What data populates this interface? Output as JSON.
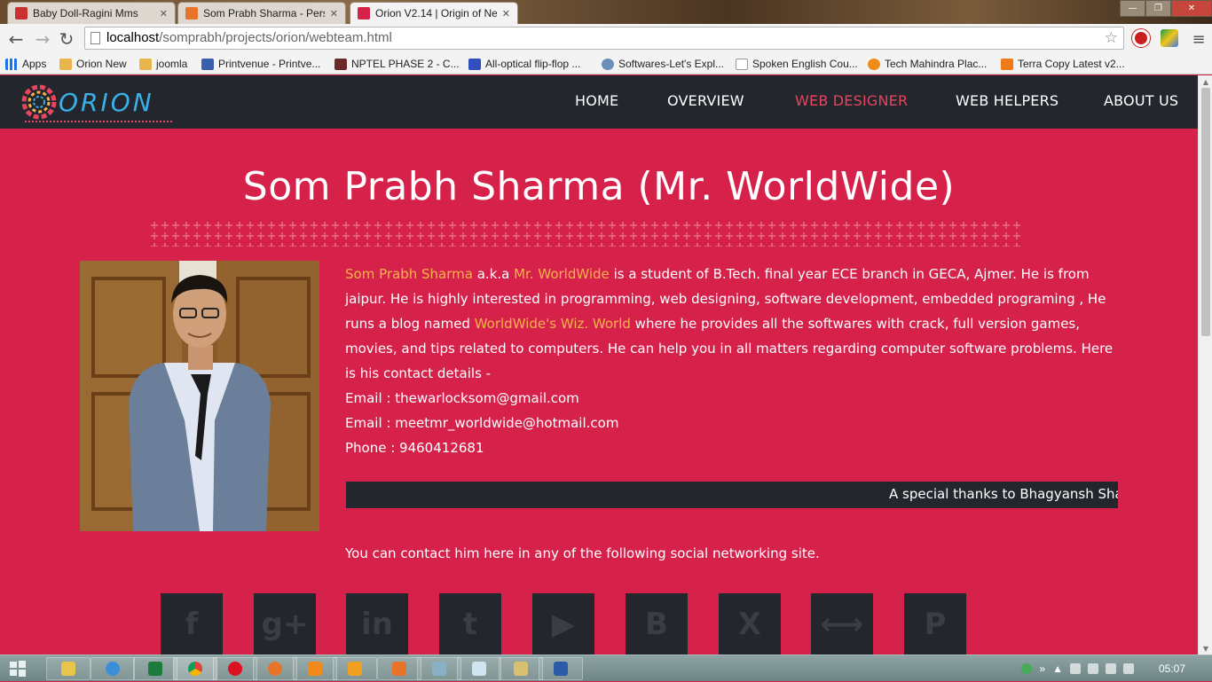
{
  "browser": {
    "tabs": [
      {
        "label": "Baby Doll-Ragini Mms",
        "icon": "gaana-icon",
        "color": "#c8312f"
      },
      {
        "label": "Som Prabh Sharma - Pers",
        "icon": "orion-icon",
        "color": "#e8742b"
      },
      {
        "label": "Orion V2.14 | Origin of Ne",
        "icon": "orion-icon",
        "color": "#d6214a"
      }
    ],
    "url_host": "localhost",
    "url_path": "/somprabh/projects/orion/webteam.html",
    "bookmarks": [
      {
        "label": "Apps",
        "icon": "apps-grid-icon"
      },
      {
        "label": "Orion New",
        "icon": "folder-icon"
      },
      {
        "label": "joomla",
        "icon": "folder-icon"
      },
      {
        "label": "Printvenue - Printve...",
        "icon": "printvenue-icon"
      },
      {
        "label": "NPTEL PHASE 2 - C...",
        "icon": "nptel-icon"
      },
      {
        "label": "All-optical flip-flop ...",
        "icon": "document-icon"
      },
      {
        "label": "Softwares-Let's Expl...",
        "icon": "globe-icon"
      },
      {
        "label": "Spoken English Cou...",
        "icon": "page-icon"
      },
      {
        "label": "Tech Mahindra Plac...",
        "icon": "info-icon"
      },
      {
        "label": "Terra Copy Latest v2...",
        "icon": "blogger-icon"
      }
    ]
  },
  "site": {
    "logo_text": "ORION",
    "nav": [
      "HOME",
      "OVERVIEW",
      "WEB DESIGNER",
      "WEB HELPERS",
      "ABOUT US"
    ],
    "active_nav": "WEB DESIGNER",
    "title": "Som Prabh Sharma (Mr. WorldWide)",
    "bio": {
      "name": "Som Prabh Sharma",
      "aka": " a.k.a ",
      "alias": "Mr. WorldWide",
      "text1": " is a student of B.Tech. final year ECE branch in GECA, Ajmer. He is from jaipur. He is highly interested in programming, web designing, software development, embedded programing , He runs a blog named ",
      "blog": "WorldWide's Wiz. World",
      "text2": " where he provides all the softwares with crack, full version games, movies, and tips related to computers. He can help you in all matters regarding computer software problems. Here is his contact details -",
      "email1": "Email : thewarlocksom@gmail.com",
      "email2": "Email : meetmr_worldwide@hotmail.com",
      "phone": "Phone : 9460412681"
    },
    "marquee": "A special thanks to Bhagyansh Sha",
    "contact_msg": "You can contact him here in any of the following social networking site.",
    "social": [
      {
        "name": "facebook",
        "glyph": "f"
      },
      {
        "name": "google-plus",
        "glyph": "g+"
      },
      {
        "name": "linkedin",
        "glyph": "in"
      },
      {
        "name": "twitter",
        "glyph": "t"
      },
      {
        "name": "youtube",
        "glyph": "▶"
      },
      {
        "name": "blogger",
        "glyph": "B"
      },
      {
        "name": "xing",
        "glyph": "X"
      },
      {
        "name": "link",
        "glyph": "⟷"
      },
      {
        "name": "pinterest",
        "glyph": "P"
      }
    ],
    "colors": {
      "bg": "#d6214a",
      "dark": "#23262d",
      "highlight": "#f5b34a",
      "nav_active": "#e8455f"
    }
  },
  "taskbar": {
    "clock": "05:07"
  }
}
